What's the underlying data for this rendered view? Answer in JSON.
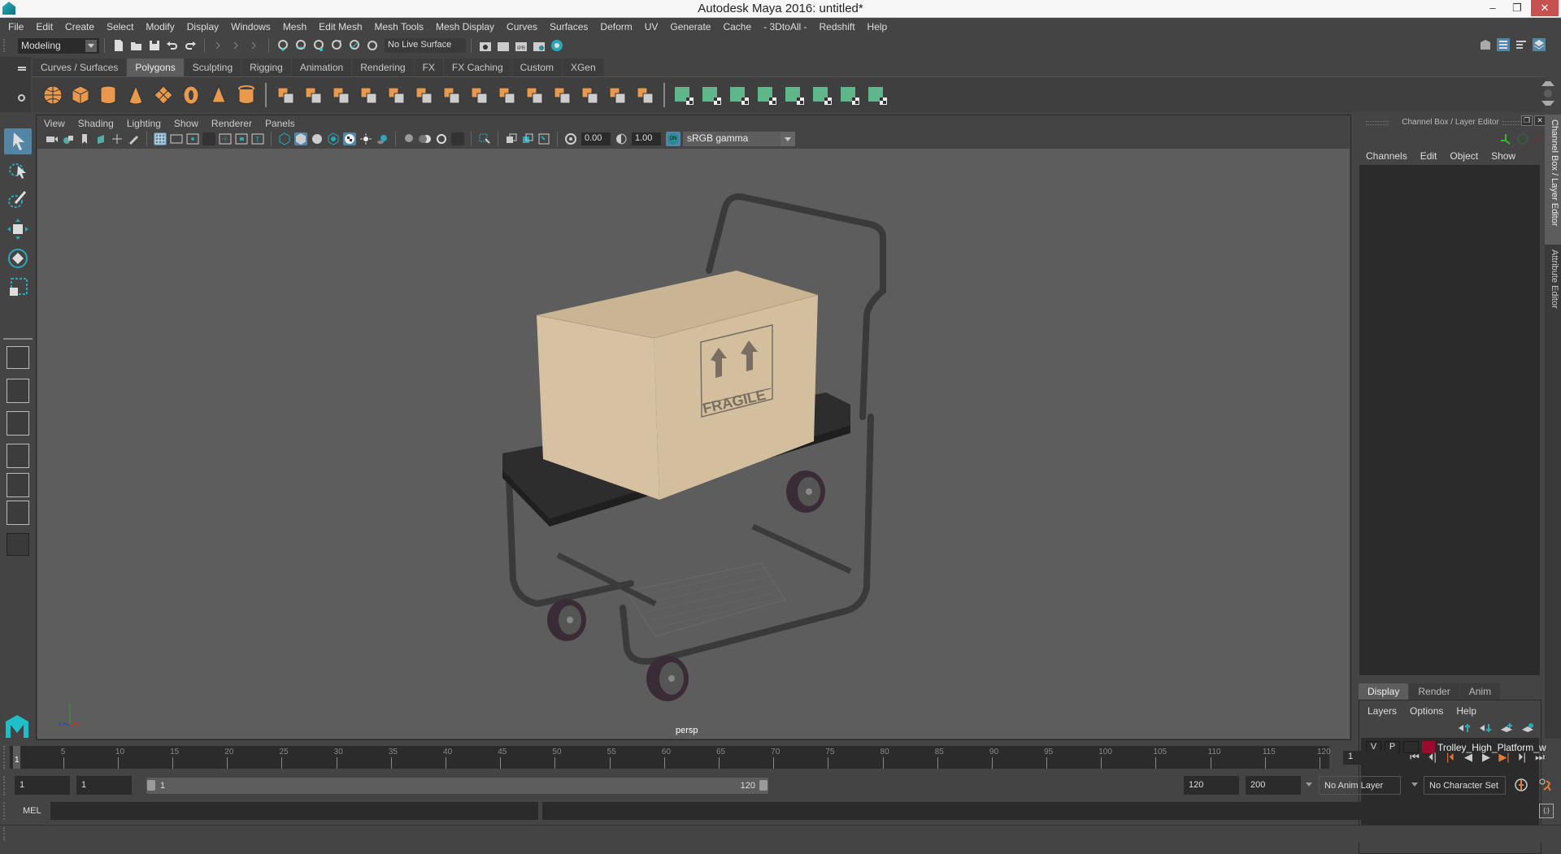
{
  "window": {
    "title": "Autodesk Maya 2016: untitled*",
    "minimize": "–",
    "maximize": "❐",
    "close": "✕"
  },
  "menubar": [
    "File",
    "Edit",
    "Create",
    "Select",
    "Modify",
    "Display",
    "Windows",
    "Mesh",
    "Edit Mesh",
    "Mesh Tools",
    "Mesh Display",
    "Curves",
    "Surfaces",
    "Deform",
    "UV",
    "Generate",
    "Cache",
    "- 3DtoAll -",
    "Redshift",
    "Help"
  ],
  "statusline": {
    "mode": "Modeling",
    "live_surface": "No Live Surface"
  },
  "shelf": {
    "tabs": [
      {
        "label": "Curves / Surfaces",
        "active": false
      },
      {
        "label": "Polygons",
        "active": true
      },
      {
        "label": "Sculpting",
        "active": false
      },
      {
        "label": "Rigging",
        "active": false
      },
      {
        "label": "Animation",
        "active": false
      },
      {
        "label": "Rendering",
        "active": false
      },
      {
        "label": "FX",
        "active": false
      },
      {
        "label": "FX Caching",
        "active": false
      },
      {
        "label": "Custom",
        "active": false
      },
      {
        "label": "XGen",
        "active": false
      }
    ],
    "icons": [
      "poly-sphere-icon",
      "poly-cube-icon",
      "poly-cylinder-icon",
      "poly-cone-icon",
      "poly-plane-icon",
      "poly-torus-icon",
      "poly-pyramid-icon",
      "poly-pipe-icon",
      "combine-icon",
      "separate-icon",
      "mirror-icon",
      "smooth-icon",
      "extrude-icon",
      "bevel-icon",
      "bridge-icon",
      "append-icon",
      "multi-cut-icon",
      "target-weld-icon",
      "merge-icon",
      "extract-icon",
      "insert-edge-loop-icon",
      "offset-edge-loop-icon",
      "planar-mapping-icon",
      "automatic-mapping-icon",
      "cylindrical-mapping-icon",
      "spherical-mapping-icon",
      "best-plane-icon",
      "normal-mapping-icon",
      "uv-editor-icon",
      "unfold-icon"
    ]
  },
  "panel": {
    "menu": [
      "View",
      "Shading",
      "Lighting",
      "Show",
      "Renderer",
      "Panels"
    ],
    "exposure": "0.00",
    "gamma": "1.00",
    "color_management": "sRGB gamma",
    "camera_label": "persp"
  },
  "scene": {
    "box_label": "FRAGILE"
  },
  "channel_box": {
    "title": "Channel Box / Layer Editor",
    "menu": [
      "Channels",
      "Edit",
      "Object",
      "Show"
    ]
  },
  "layer_editor": {
    "tabs": [
      {
        "label": "Display",
        "active": true
      },
      {
        "label": "Render",
        "active": false
      },
      {
        "label": "Anim",
        "active": false
      }
    ],
    "menu": [
      "Layers",
      "Options",
      "Help"
    ],
    "layers": [
      {
        "v": "V",
        "p": "P",
        "color": "#9b0b2e",
        "name": "Trolley_High_Platform_w"
      }
    ]
  },
  "side_tabs": [
    "Channel Box / Layer Editor",
    "Attribute Editor"
  ],
  "timeline": {
    "start": 1,
    "end": 120,
    "current": 1,
    "tick_labels": [
      5,
      10,
      15,
      20,
      25,
      30,
      35,
      40,
      45,
      50,
      55,
      60,
      65,
      70,
      75,
      80,
      85,
      90,
      95,
      100,
      105,
      110,
      115,
      120
    ],
    "current_frame_field": "1"
  },
  "playback": [
    "⏮",
    "⏴|",
    "|⏴",
    "◀",
    "▶",
    "▶|",
    "⏵|",
    "⏭"
  ],
  "range": {
    "start_field": "1",
    "playback_start_field": "1",
    "slider_start": "1",
    "slider_end": "120",
    "playback_end_field": "120",
    "end_field": "200",
    "anim_layer": "No Anim Layer",
    "character_set": "No Character Set"
  },
  "command_line": {
    "language": "MEL",
    "input": ""
  }
}
